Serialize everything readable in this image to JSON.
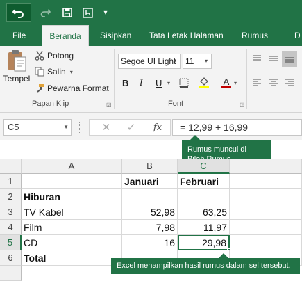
{
  "qat": {
    "undo_icon": "undo-icon",
    "redo_icon": "redo-icon",
    "save_icon": "save-icon",
    "touch_icon": "touch-mode-icon",
    "more_icon": "customize-qat-icon"
  },
  "tabs": [
    "File",
    "Beranda",
    "Sisipkan",
    "Tata Letak Halaman",
    "Rumus",
    "D"
  ],
  "active_tab": "Beranda",
  "clipboard": {
    "paste_label": "Tempel",
    "cut_label": "Potong",
    "copy_label": "Salin",
    "format_painter_label": "Pewarna Format",
    "group_label": "Papan Klip"
  },
  "font": {
    "family_value": "Segoe UI Light",
    "size_value": "11",
    "group_label": "Font",
    "bold": "B",
    "italic": "I",
    "underline": "U",
    "font_color_letter": "A"
  },
  "formula_bar": {
    "name_box": "C5",
    "cancel_symbol": "✕",
    "enter_symbol": "✓",
    "fx_symbol": "fx",
    "formula": "= 12,99 + 16,99"
  },
  "sheet": {
    "columns": [
      "A",
      "B",
      "C"
    ],
    "rows": [
      "1",
      "2",
      "3",
      "4",
      "5",
      "6"
    ],
    "selected_cell": "C5",
    "cells": {
      "r1": {
        "a": "",
        "b": "Januari",
        "c": "Februari"
      },
      "r2": {
        "a": "Hiburan",
        "b": "",
        "c": ""
      },
      "r3": {
        "a": "TV Kabel",
        "b": "52,98",
        "c": "63,25"
      },
      "r4": {
        "a": "Film",
        "b": "7,98",
        "c": "11,97"
      },
      "r5": {
        "a": "CD",
        "b": "16",
        "c": "29,98"
      },
      "r6": {
        "a": "Total",
        "b": "",
        "c": ""
      }
    }
  },
  "callouts": {
    "formula_bar_note": "Rumus muncul di Bilah Rumus.",
    "result_note": "Excel menampilkan hasil rumus dalam sel tersebut."
  },
  "colors": {
    "accent": "#217346",
    "ribbon_bg": "#f3f3f3",
    "font_color_swatch": "#c00000",
    "highlight_swatch": "#ffff00"
  }
}
